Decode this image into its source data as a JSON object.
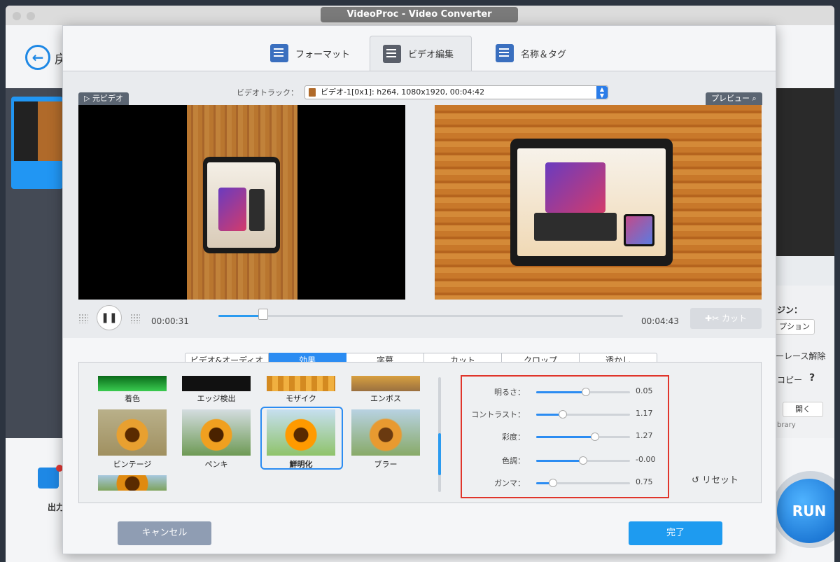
{
  "window": {
    "title": "VideoProc - Video Converter"
  },
  "background_app": {
    "back_label": "戻",
    "right_panel": [
      "ジン：",
      "プション",
      "ーレース解除",
      "コピー",
      "?",
      "開く",
      "brary"
    ],
    "output_label": "出力",
    "run_label": "RUN"
  },
  "dialog": {
    "tabs": [
      {
        "label": "フォーマット",
        "icon": "format-settings-icon"
      },
      {
        "label": "ビデオ編集",
        "icon": "video-edit-icon",
        "active": true
      },
      {
        "label": "名称＆タグ",
        "icon": "name-tag-icon"
      }
    ],
    "track": {
      "label": "ビデオトラック：",
      "value": "ビデオ-1[0x1]: h264, 1080x1920, 00:04:42"
    },
    "source_label": "▷ 元ビデオ",
    "preview_label": "プレビュー",
    "player": {
      "current_time": "00:00:31",
      "total_time": "00:04:43",
      "progress": 0.11,
      "cut_label": "カット"
    },
    "subtabs": [
      {
        "label": "ビデオ&オーディオ"
      },
      {
        "label": "効果",
        "active": true
      },
      {
        "label": "字幕"
      },
      {
        "label": "カット"
      },
      {
        "label": "クロップ"
      },
      {
        "label": "透かし"
      }
    ],
    "effects": [
      {
        "label": "着色"
      },
      {
        "label": "エッジ検出"
      },
      {
        "label": "モザイク"
      },
      {
        "label": "エンボス"
      },
      {
        "label": "ビンテージ"
      },
      {
        "label": "ペンキ"
      },
      {
        "label": "鮮明化",
        "selected": true
      },
      {
        "label": "ブラー"
      }
    ],
    "adjustments": [
      {
        "label": "明るさ：",
        "value": "0.05",
        "position": 0.53
      },
      {
        "label": "コントラスト：",
        "value": "1.17",
        "position": 0.28
      },
      {
        "label": "彩度：",
        "value": "1.27",
        "position": 0.63
      },
      {
        "label": "色調：",
        "value": "-0.00",
        "position": 0.5
      },
      {
        "label": "ガンマ：",
        "value": "0.75",
        "position": 0.18
      }
    ],
    "reset_label": "リセット",
    "cancel_label": "キャンセル",
    "done_label": "完了"
  },
  "colors": {
    "accent": "#2b8cf2",
    "highlight_border": "#e0352b",
    "done_button": "#1e9bf0",
    "cancel_button": "#8f9db3"
  }
}
